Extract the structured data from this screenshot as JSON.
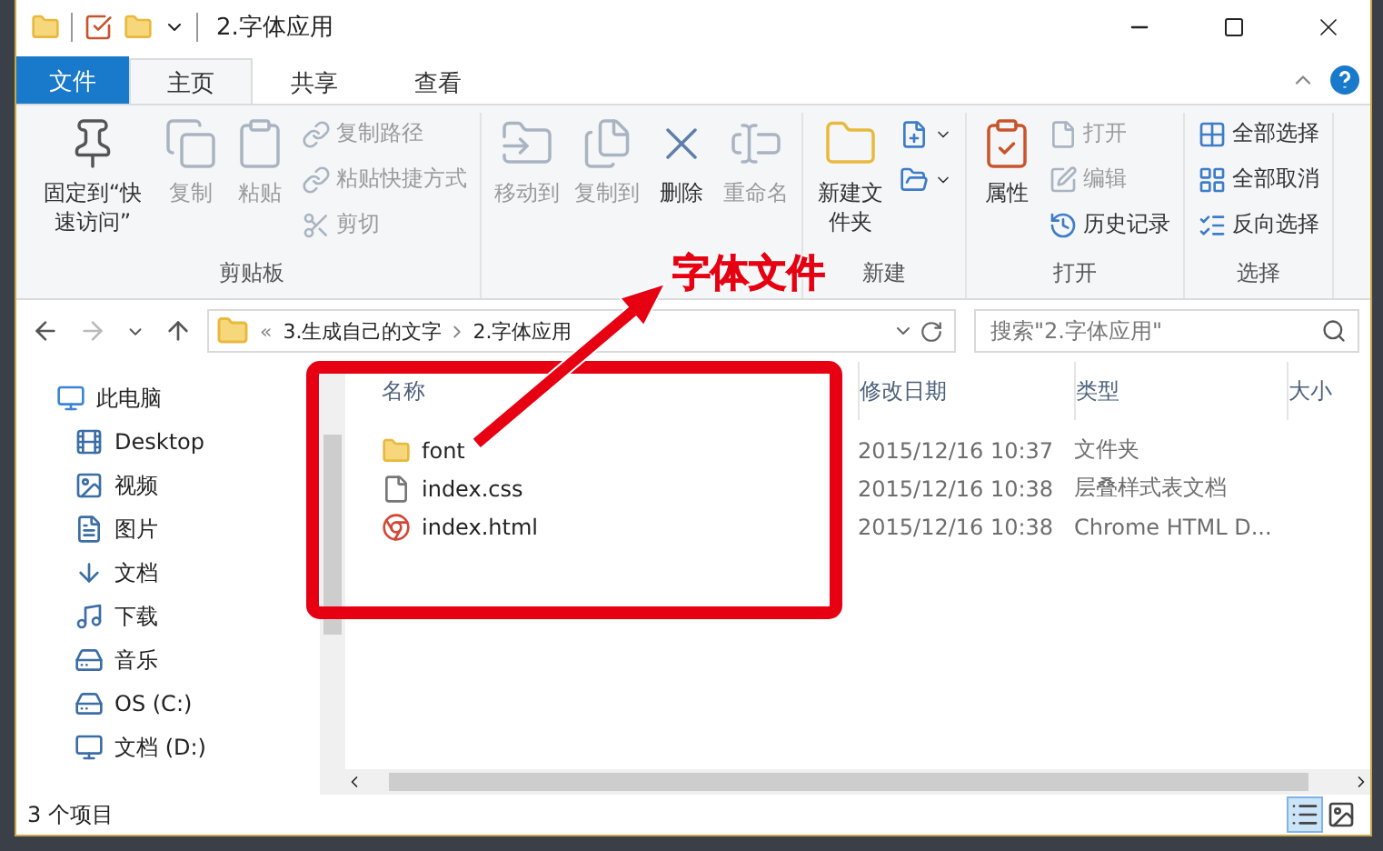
{
  "window": {
    "title": "2.字体应用"
  },
  "ribbon_tabs": [
    {
      "label": "文件",
      "kind": "file",
      "selected": false
    },
    {
      "label": "主页",
      "kind": "tab",
      "selected": true
    },
    {
      "label": "共享",
      "kind": "tab",
      "selected": false
    },
    {
      "label": "查看",
      "kind": "tab",
      "selected": false
    }
  ],
  "ribbon_groups": [
    {
      "label": "剪贴板",
      "items": [
        {
          "kind": "large",
          "label": "固定到“快速访问”",
          "disabled": false
        },
        {
          "kind": "large",
          "label": "复制",
          "disabled": true
        },
        {
          "kind": "large",
          "label": "粘贴",
          "disabled": true
        },
        {
          "kind": "small",
          "label": "复制路径",
          "disabled": true
        },
        {
          "kind": "small",
          "label": "粘贴快捷方式",
          "disabled": true
        },
        {
          "kind": "small",
          "label": "剪切",
          "disabled": true
        }
      ]
    },
    {
      "items": [
        {
          "kind": "large",
          "label": "移动到",
          "disabled": true
        },
        {
          "kind": "large",
          "label": "复制到",
          "disabled": true
        },
        {
          "kind": "large",
          "label": "删除",
          "disabled": false
        },
        {
          "kind": "large",
          "label": "重命名",
          "disabled": true
        }
      ]
    },
    {
      "label": "新建",
      "items": [
        {
          "kind": "large",
          "label": "新建文件夹",
          "disabled": false
        },
        {
          "kind": "small",
          "disabled": false
        },
        {
          "kind": "small",
          "disabled": false
        }
      ]
    },
    {
      "label": "打开",
      "items": [
        {
          "kind": "large",
          "label": "属性",
          "disabled": false
        },
        {
          "kind": "small",
          "label": "打开",
          "disabled": true
        },
        {
          "kind": "small",
          "label": "编辑",
          "disabled": true
        },
        {
          "kind": "small",
          "label": "历史记录",
          "disabled": false
        }
      ]
    },
    {
      "label": "选择",
      "items": [
        {
          "kind": "small",
          "label": "全部选择",
          "disabled": false
        },
        {
          "kind": "small",
          "label": "全部取消",
          "disabled": false
        },
        {
          "kind": "small",
          "label": "反向选择",
          "disabled": false
        }
      ]
    }
  ],
  "address": {
    "prefix": "«",
    "crumbs": [
      "3.生成自己的文字",
      "2.字体应用"
    ]
  },
  "search": {
    "placeholder": "搜索\"2.字体应用\""
  },
  "nav": [
    {
      "label": "此电脑",
      "children": [
        {
          "label": "Desktop"
        },
        {
          "label": "视频"
        },
        {
          "label": "图片"
        },
        {
          "label": "文档"
        },
        {
          "label": "下载"
        },
        {
          "label": "音乐"
        },
        {
          "label": "OS (C:)"
        },
        {
          "label": "文档 (D:)"
        }
      ]
    }
  ],
  "columns": [
    "名称",
    "修改日期",
    "类型",
    "大小"
  ],
  "files": [
    {
      "kind": "folder",
      "name": "font",
      "date": "2015/12/16 10:37",
      "type": "文件夹"
    },
    {
      "kind": "css",
      "name": "index.css",
      "date": "2015/12/16 10:38",
      "type": "层叠样式表文档"
    },
    {
      "kind": "html",
      "name": "index.html",
      "date": "2015/12/16 10:38",
      "type": "Chrome HTML D..."
    }
  ],
  "status_bar": {
    "count": "3 个项目"
  },
  "annotation": {
    "label": "字体文件"
  }
}
